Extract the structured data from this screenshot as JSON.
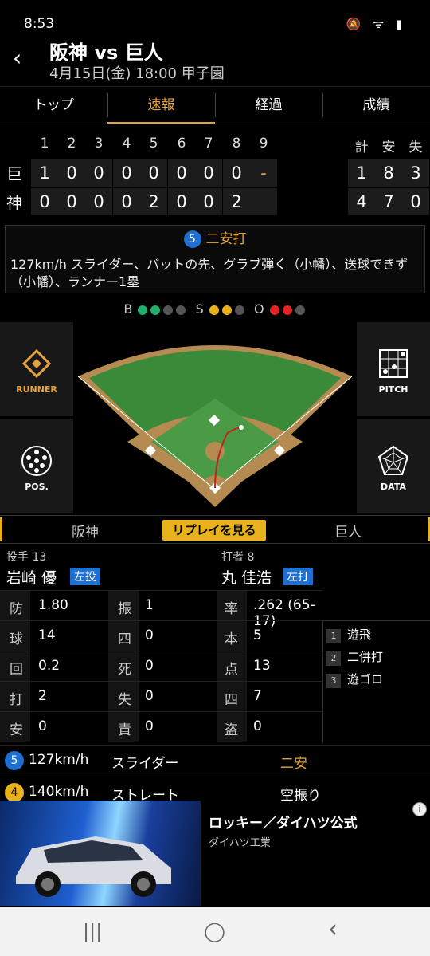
{
  "status": {
    "time": "8:53",
    "icons": "🔕 ᯤ ▮"
  },
  "header": {
    "back_icon": "‹",
    "title": "阪神 vs 巨人",
    "subtitle": "4月15日(金) 18:00 甲子園"
  },
  "tabs": [
    "トップ",
    "速報",
    "経過",
    "成績"
  ],
  "active_tab": "速報",
  "scoreboard": {
    "innings": [
      "1",
      "2",
      "3",
      "4",
      "5",
      "6",
      "7",
      "8",
      "9"
    ],
    "totals_header": [
      "計",
      "安",
      "失"
    ],
    "rows": [
      {
        "team": "巨",
        "innings": [
          "1",
          "0",
          "0",
          "0",
          "0",
          "0",
          "0",
          "0",
          "-"
        ],
        "totals": [
          "1",
          "8",
          "3"
        ]
      },
      {
        "team": "神",
        "innings": [
          "0",
          "0",
          "0",
          "0",
          "2",
          "0",
          "0",
          "2",
          ""
        ],
        "totals": [
          "4",
          "7",
          "0"
        ]
      }
    ]
  },
  "play": {
    "number": "5",
    "headline": "二安打",
    "description": "127km/h スライダー、バットの先、グラブ弾く（小幡）、送球できず（小幡）、ランナー1塁"
  },
  "count": {
    "b_label": "B",
    "s_label": "S",
    "o_label": "O",
    "balls": 2,
    "strikes": 2,
    "outs": 2
  },
  "side_buttons": {
    "runner": "RUNNER",
    "pitch": "PITCH",
    "pos": "POS.",
    "data": "DATA"
  },
  "teambar": {
    "left": "阪神",
    "replay": "リプレイを見る",
    "right": "巨人"
  },
  "pitcher": {
    "role": "投手 13",
    "name": "岩崎 優",
    "tag": "左投"
  },
  "batter": {
    "role": "打者 8",
    "name": "丸 佳浩",
    "tag": "左打"
  },
  "pitcher_stats": [
    {
      "k1": "防",
      "v1": "1.80",
      "k2": "振",
      "v2": "1"
    },
    {
      "k1": "球",
      "v1": "14",
      "k2": "四",
      "v2": "0"
    },
    {
      "k1": "回",
      "v1": "0.2",
      "k2": "死",
      "v2": "0"
    },
    {
      "k1": "打",
      "v1": "2",
      "k2": "失",
      "v2": "0"
    },
    {
      "k1": "安",
      "v1": "0",
      "k2": "責",
      "v2": "0"
    }
  ],
  "batter_stats": [
    {
      "k": "率",
      "v": ".262 (65-17)"
    },
    {
      "k": "本",
      "v": "5"
    },
    {
      "k": "点",
      "v": "13"
    },
    {
      "k": "四",
      "v": "7"
    },
    {
      "k": "盗",
      "v": "0"
    }
  ],
  "at_bats": [
    {
      "n": "1",
      "r": "遊飛"
    },
    {
      "n": "2",
      "r": "二併打"
    },
    {
      "n": "3",
      "r": "遊ゴロ"
    }
  ],
  "pitches": [
    {
      "n": "5",
      "color": "#1e6fd0",
      "speed": "127km/h",
      "type": "スライダー",
      "result": "二安",
      "result_color": "#e6a33a"
    },
    {
      "n": "4",
      "color": "#e8b21c",
      "speed": "140km/h",
      "type": "ストレート",
      "result": "空振り",
      "result_color": "#ffffff"
    }
  ],
  "ad": {
    "title": "ロッキー／ダイハツ公式",
    "sub": "ダイハツ工業",
    "info_icon": "i"
  },
  "nav": {
    "recents": "|||",
    "home": "◯",
    "back": "‹"
  }
}
